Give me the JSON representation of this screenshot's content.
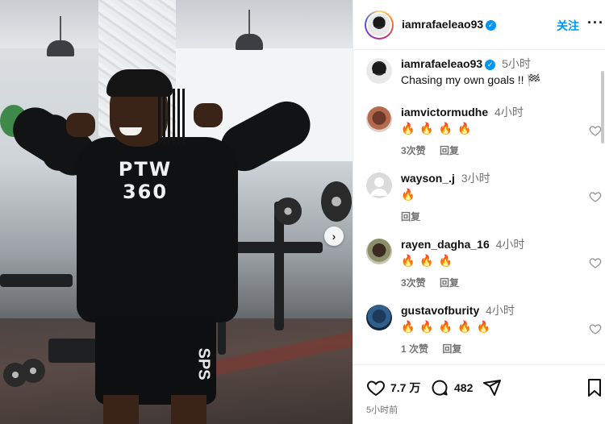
{
  "post": {
    "author": "iamrafaeleao93",
    "follow_label": "关注",
    "more_label": "···",
    "chest_logo": "PTW 360",
    "shorts_logo": "SPS",
    "caption": {
      "username": "iamrafaeleao93",
      "time": "5小时",
      "text": "Chasing my own goals !! 🏁"
    }
  },
  "comments": [
    {
      "username": "iamvictormudhe",
      "time": "4小时",
      "text": "🔥🔥🔥🔥",
      "likes": "3次赞",
      "reply": "回复"
    },
    {
      "username": "wayson_.j",
      "time": "3小时",
      "text": "🔥",
      "likes": "",
      "reply": "回复"
    },
    {
      "username": "rayen_dagha_16",
      "time": "4小时",
      "text": "🔥🔥🔥",
      "likes": "3次赞",
      "reply": "回复"
    },
    {
      "username": "gustavofburity",
      "time": "4小时",
      "text": "🔥🔥🔥🔥🔥",
      "likes": "1 次赞",
      "reply": "回复"
    }
  ],
  "actions": {
    "likes_count": "7.7 万",
    "comments_count": "482",
    "time_ago": "5小时前"
  },
  "icons": {
    "next": "chevron-right-icon",
    "like": "heart-icon",
    "comment": "comment-icon",
    "share": "share-icon",
    "save": "bookmark-icon",
    "verified": "verified-badge-icon"
  },
  "colors": {
    "accent": "#0095f6",
    "meta_text": "#737373",
    "fire": "#f0600a"
  }
}
